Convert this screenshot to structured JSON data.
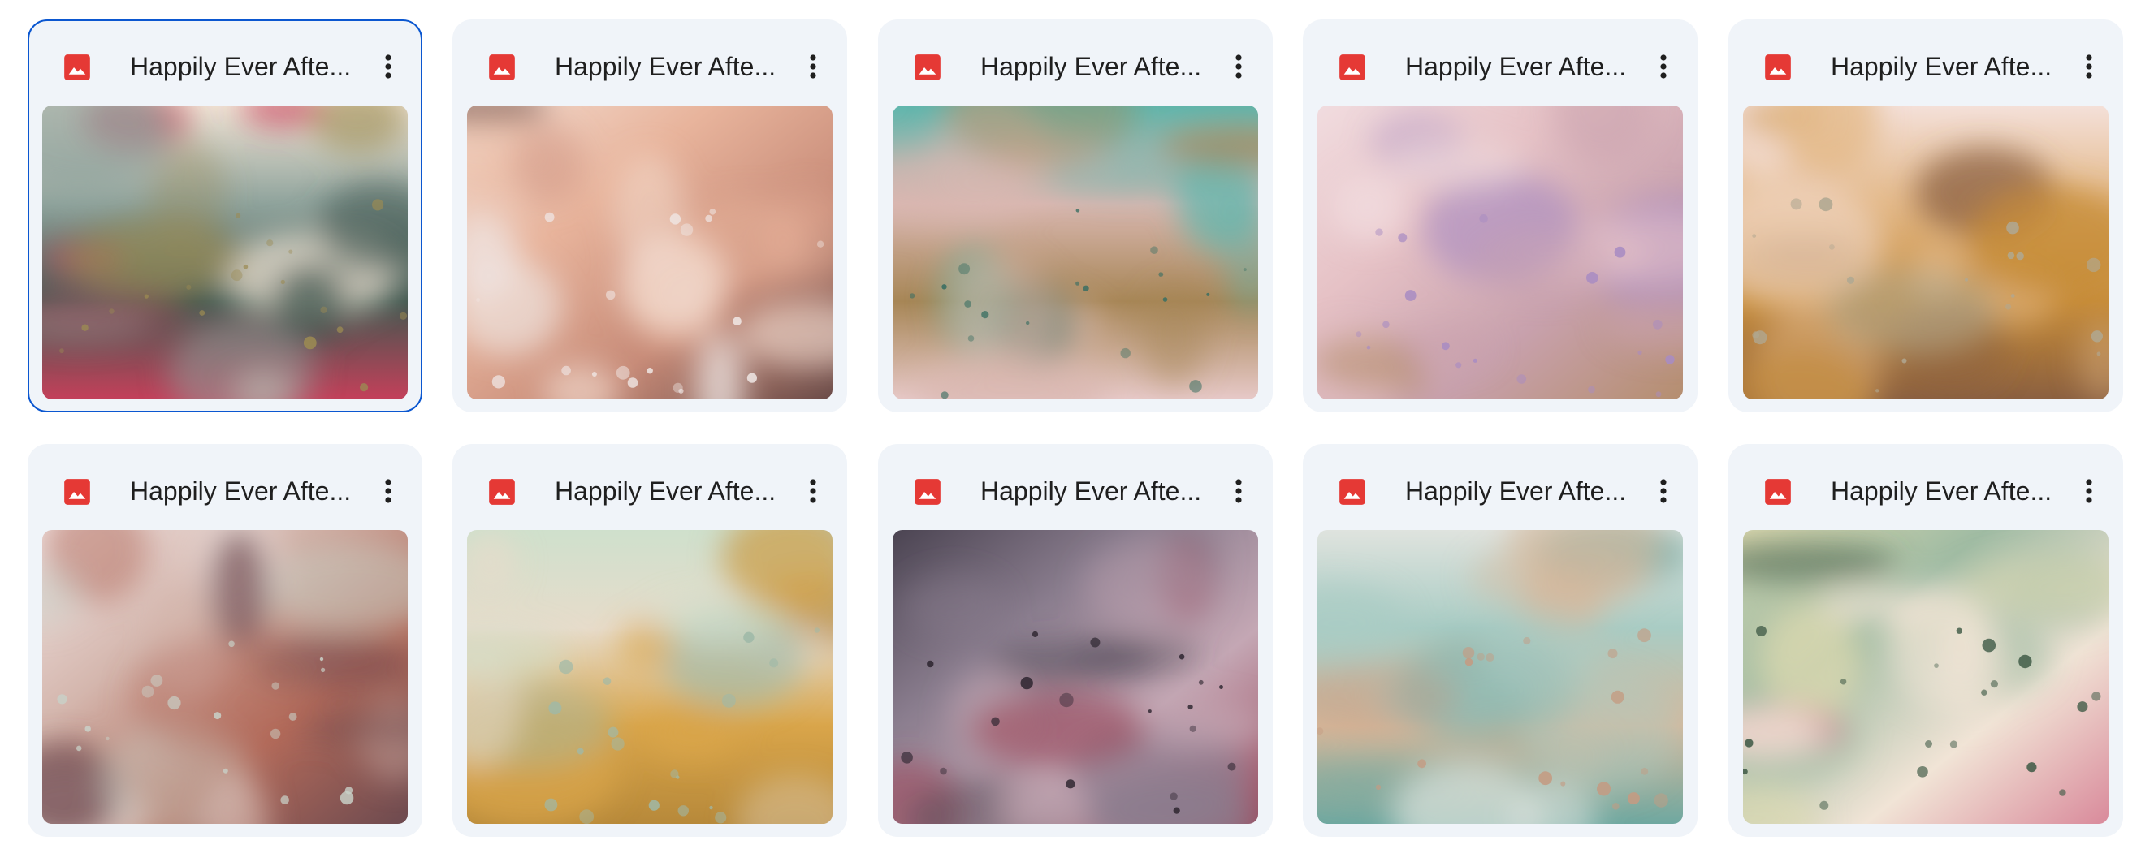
{
  "files": [
    {
      "title": "Happily Ever Afte...",
      "icon": "image-file-icon",
      "icon_color": "#e53935",
      "selected": true,
      "palette": [
        "#efe3d4",
        "#8fa39c",
        "#41574f",
        "#c4405a",
        "#9b8a52"
      ]
    },
    {
      "title": "Happily Ever Afte...",
      "icon": "image-file-icon",
      "icon_color": "#e53935",
      "selected": false,
      "palette": [
        "#f3dcd0",
        "#e8b49c",
        "#c78b78",
        "#6b4b48",
        "#efe6e4"
      ]
    },
    {
      "title": "Happily Ever Afte...",
      "icon": "image-file-icon",
      "icon_color": "#e53935",
      "selected": false,
      "palette": [
        "#5fb6ad",
        "#d9b7b0",
        "#a78656",
        "#e7c9c8",
        "#3b6f63"
      ]
    },
    {
      "title": "Happily Ever Afte...",
      "icon": "image-file-icon",
      "icon_color": "#e53935",
      "selected": false,
      "palette": [
        "#f1dcdf",
        "#e6c2c6",
        "#c8a1ad",
        "#b58e6f",
        "#a98cc2"
      ]
    },
    {
      "title": "Happily Ever Afte...",
      "icon": "image-file-icon",
      "icon_color": "#e53935",
      "selected": false,
      "palette": [
        "#f4e0d9",
        "#e3b887",
        "#c68b37",
        "#8b6040",
        "#b0a892"
      ]
    },
    {
      "title": "Happily Ever Afte...",
      "icon": "image-file-icon",
      "icon_color": "#e53935",
      "selected": false,
      "palette": [
        "#f0e2e0",
        "#d4b6ad",
        "#b26a5a",
        "#6d4a4f",
        "#c9d1c8"
      ]
    },
    {
      "title": "Happily Ever Afte...",
      "icon": "image-file-icon",
      "icon_color": "#e53935",
      "selected": false,
      "palette": [
        "#cfe0cc",
        "#e7dccb",
        "#d9a54a",
        "#b7893a",
        "#9fb9a8"
      ]
    },
    {
      "title": "Happily Ever Afte...",
      "icon": "image-file-icon",
      "icon_color": "#e53935",
      "selected": false,
      "palette": [
        "#4b4452",
        "#8a7d8e",
        "#c4a7b4",
        "#9c4a5e",
        "#2e2630"
      ]
    },
    {
      "title": "Happily Ever Afte...",
      "icon": "image-file-icon",
      "icon_color": "#e53935",
      "selected": false,
      "palette": [
        "#dfe3de",
        "#a9ccc4",
        "#d6b89b",
        "#6fa8a0",
        "#c49b82"
      ]
    },
    {
      "title": "Happily Ever Afte...",
      "icon": "image-file-icon",
      "icon_color": "#e53935",
      "selected": false,
      "palette": [
        "#dcd9b0",
        "#9fbba3",
        "#f1e4d6",
        "#d98a9b",
        "#3f5a46"
      ]
    }
  ],
  "more_icon": "more-vert-icon"
}
